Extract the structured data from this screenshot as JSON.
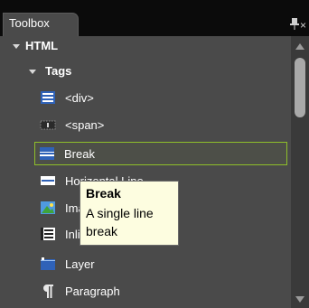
{
  "toolbox": {
    "title": "Toolbox",
    "close_glyph": "×",
    "section": {
      "label": "HTML"
    },
    "group": {
      "label": "Tags"
    },
    "items": [
      {
        "label": "<div>",
        "icon": "div-icon"
      },
      {
        "label": "<span>",
        "icon": "span-icon"
      },
      {
        "label": "Break",
        "icon": "break-icon",
        "selected": true
      },
      {
        "label": "Horizontal Line",
        "icon": "horizontal-line-icon"
      },
      {
        "label": "Image",
        "icon": "image-icon"
      },
      {
        "label": "Inline Frame",
        "icon": "inline-frame-icon"
      },
      {
        "label": "Layer",
        "icon": "layer-icon"
      },
      {
        "label": "Paragraph",
        "icon": "paragraph-icon"
      }
    ]
  },
  "tooltip": {
    "title": "Break",
    "body": "A single line break"
  },
  "colors": {
    "background": "#0b0b0b",
    "panel": "#4a4a4a",
    "selection_border": "#8fbf2a",
    "tooltip_bg": "#fdfde0"
  }
}
